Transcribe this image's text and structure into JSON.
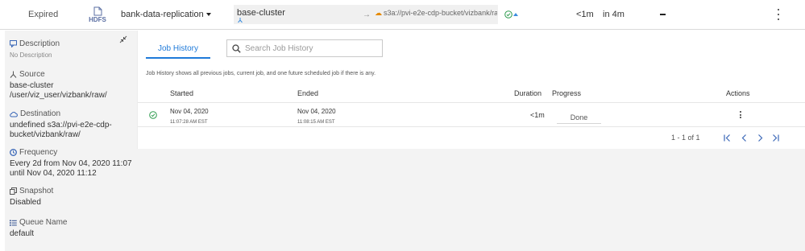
{
  "policy_row": {
    "status": "Expired",
    "type_icon": "hdfs-icon",
    "type_label": "HDFS",
    "name": "bank-data-replication",
    "source_cluster": "base-cluster",
    "destination": "s3a://pvi-e2e-cdp-bucket/vizbank/ra...",
    "last_duration": "<1m",
    "next_run": "in 4m",
    "job_indicator": "—"
  },
  "details": {
    "description": {
      "label": "Description",
      "value": "No Description",
      "icon": "comment-icon"
    },
    "source": {
      "label": "Source",
      "lines": [
        "base-cluster",
        "/user/viz_user/vizbank/raw/"
      ],
      "icon": "source-icon"
    },
    "destination": {
      "label": "Destination",
      "lines": [
        "undefined s3a://pvi-e2e-cdp-",
        "bucket/vizbank/raw/"
      ],
      "icon": "cloud-icon"
    },
    "frequency": {
      "label": "Frequency",
      "lines": [
        "Every 2d from Nov 04, 2020 11:07",
        "until Nov 04, 2020 11:12"
      ],
      "icon": "clock-icon"
    },
    "snapshot": {
      "label": "Snapshot",
      "value": "Disabled",
      "icon": "copy-icon"
    },
    "queue": {
      "label": "Queue Name",
      "value": "default",
      "icon": "list-icon"
    }
  },
  "job_history": {
    "tab_label": "Job History",
    "search_placeholder": "Search Job History",
    "info": "Job History shows all previous jobs, current job, and one future scheduled job if there is any.",
    "columns": {
      "started": "Started",
      "ended": "Ended",
      "duration": "Duration",
      "progress": "Progress",
      "actions": "Actions"
    },
    "rows": [
      {
        "status": "success",
        "started_date": "Nov 04, 2020",
        "started_time": "11:07:28 AM EST",
        "ended_date": "Nov 04, 2020",
        "ended_time": "11:08:15 AM EST",
        "duration": "<1m",
        "progress": "Done"
      }
    ],
    "pagination": "1 - 1 of 1"
  },
  "colors": {
    "accent": "#1f7ad9",
    "success": "#2e9b4e",
    "cloud": "#e68a00",
    "pane": "#f3f3f3"
  }
}
